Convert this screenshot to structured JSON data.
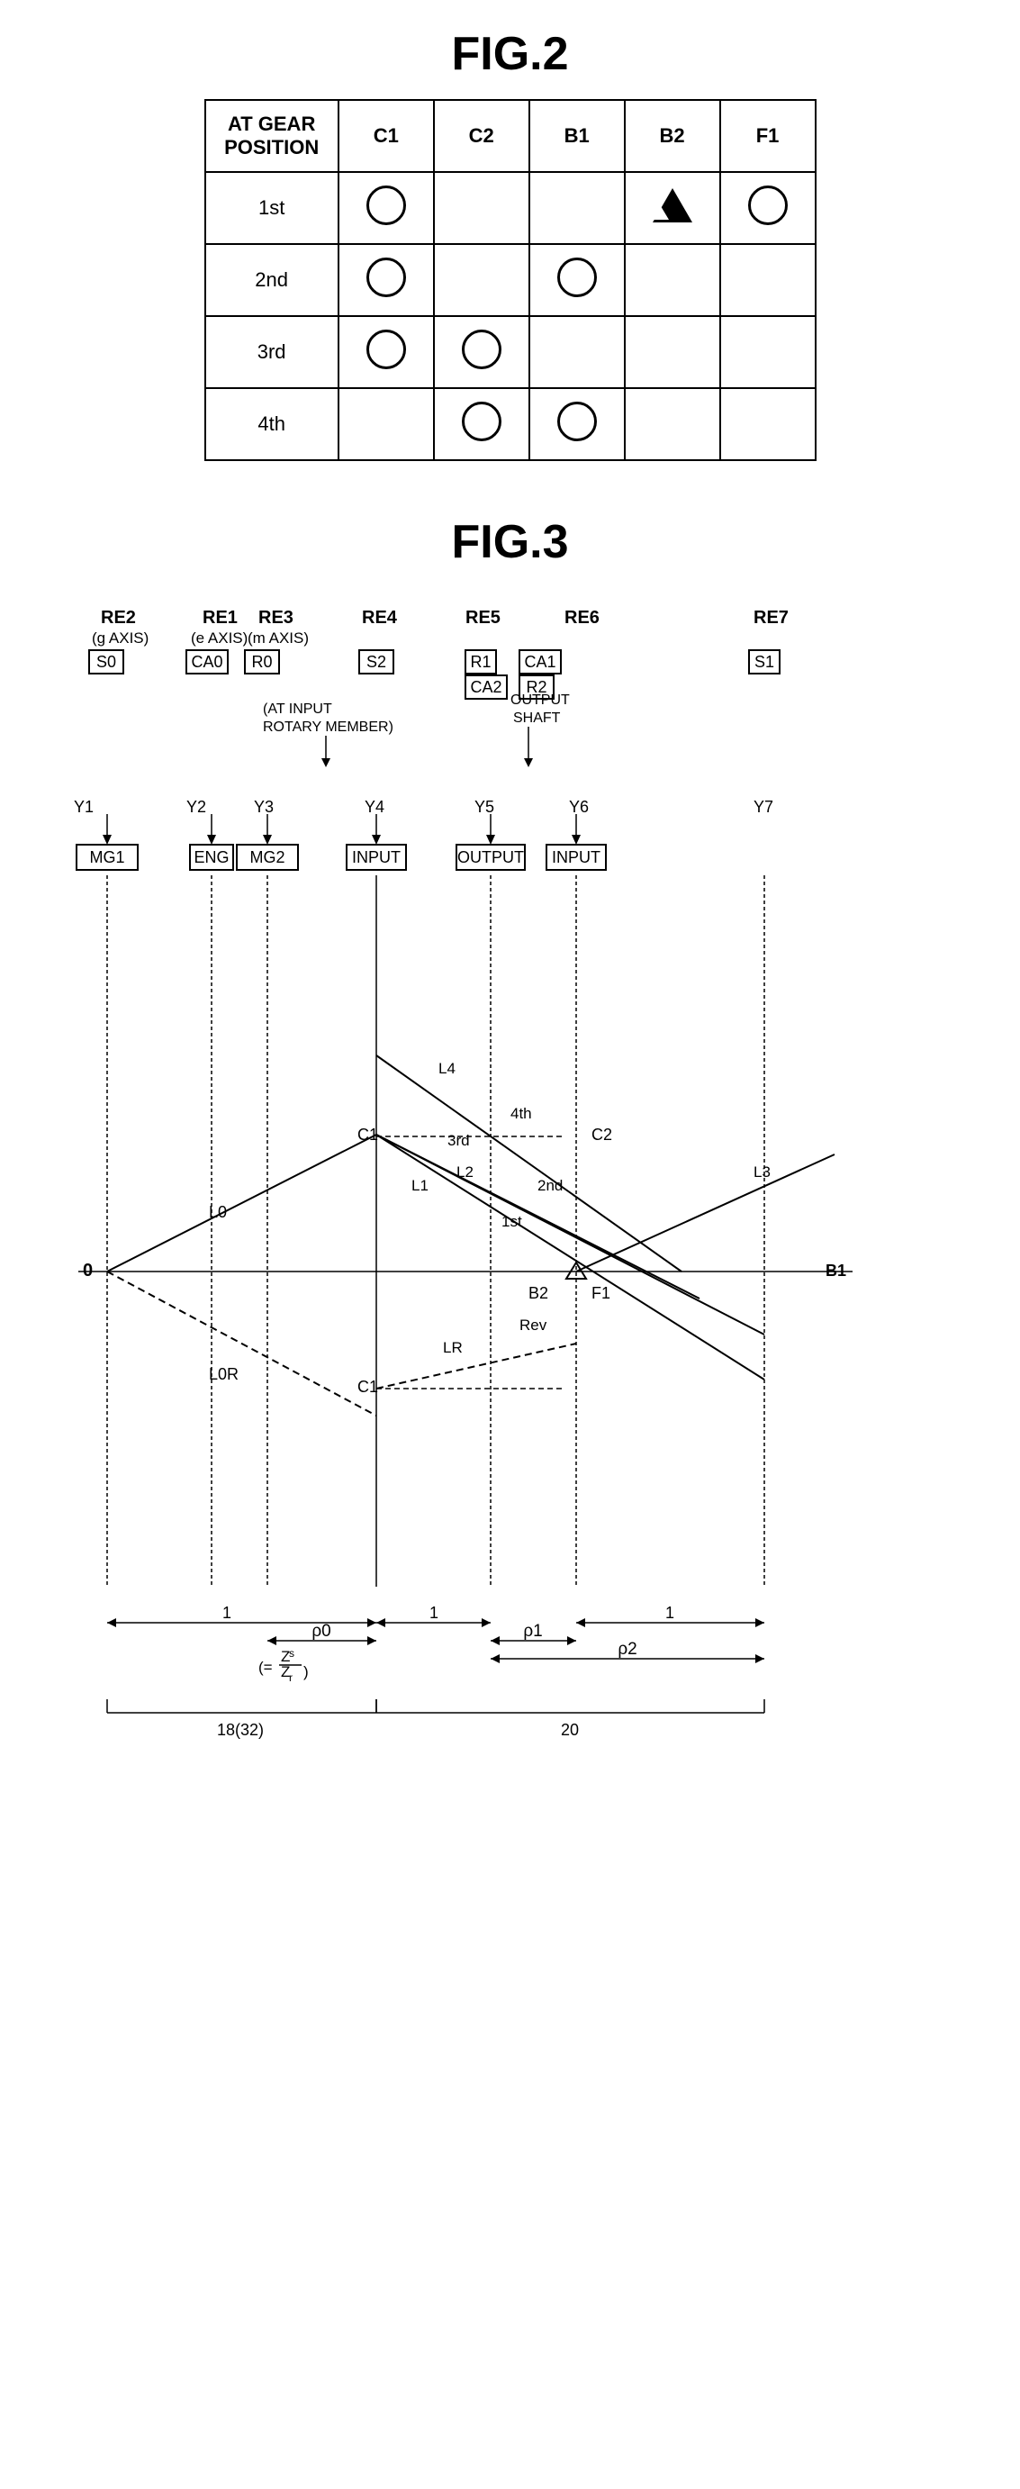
{
  "fig2": {
    "title": "FIG.2",
    "table": {
      "header": {
        "row_label": "AT GEAR\nPOSITION",
        "columns": [
          "C1",
          "C2",
          "B1",
          "B2",
          "F1"
        ]
      },
      "rows": [
        {
          "label": "1st",
          "cells": [
            "circle",
            "",
            "",
            "triangle",
            "circle"
          ]
        },
        {
          "label": "2nd",
          "cells": [
            "circle",
            "",
            "circle",
            "",
            ""
          ]
        },
        {
          "label": "3rd",
          "cells": [
            "circle",
            "circle",
            "",
            "",
            ""
          ]
        },
        {
          "label": "4th",
          "cells": [
            "",
            "circle",
            "circle",
            "",
            ""
          ]
        }
      ]
    }
  },
  "fig3": {
    "title": "FIG.3",
    "labels": {
      "RE2": "RE2",
      "RE1": "RE1",
      "RE3": "RE3",
      "RE4": "RE4",
      "RE5": "RE5",
      "RE6": "RE6",
      "RE7": "RE7",
      "g_axis": "(g AXIS)",
      "e_axis": "(e AXIS)",
      "m_axis": "(m AXIS)",
      "S0": "S0",
      "CA0": "CA0",
      "R0": "R0",
      "S2": "S2",
      "R1": "R1",
      "CA1": "CA1",
      "CA2": "CA2",
      "R2": "R2",
      "S1": "S1",
      "at_input": "(AT INPUT\nROTARY MEMBER)",
      "output_shaft": "OUTPUT\nSHAFT",
      "Y1": "Y1",
      "Y2": "Y2",
      "Y3": "Y3",
      "Y4": "Y4",
      "Y5": "Y5",
      "Y6": "Y6",
      "Y7": "Y7",
      "INPUT_box1": "INPUT",
      "OUTPUT_box": "OUTPUT",
      "INPUT_box2": "INPUT",
      "MG1": "MG1",
      "ENG": "ENG",
      "MG2": "MG2",
      "L0": "L0",
      "L0R": "L0R",
      "L1": "L1",
      "L2": "L2",
      "L3": "L3",
      "L4": "L4",
      "LR": "LR",
      "C1_upper": "C1",
      "C1_lower": "C1",
      "C2": "C2",
      "B1": "B1",
      "B2": "B2",
      "F1": "F1",
      "gear_1st": "1st",
      "gear_2nd": "2nd",
      "gear_3rd": "3rd",
      "gear_4th": "4th",
      "gear_rev": "Rev",
      "zero": "0",
      "one_left": "1",
      "rho0": "ρ0",
      "rho1": "ρ1",
      "rho2": "ρ2",
      "zs_zr": "(=⁠Zₛ/Zᵣ)",
      "bracket_18": "18(32)",
      "bracket_20": "20"
    }
  }
}
